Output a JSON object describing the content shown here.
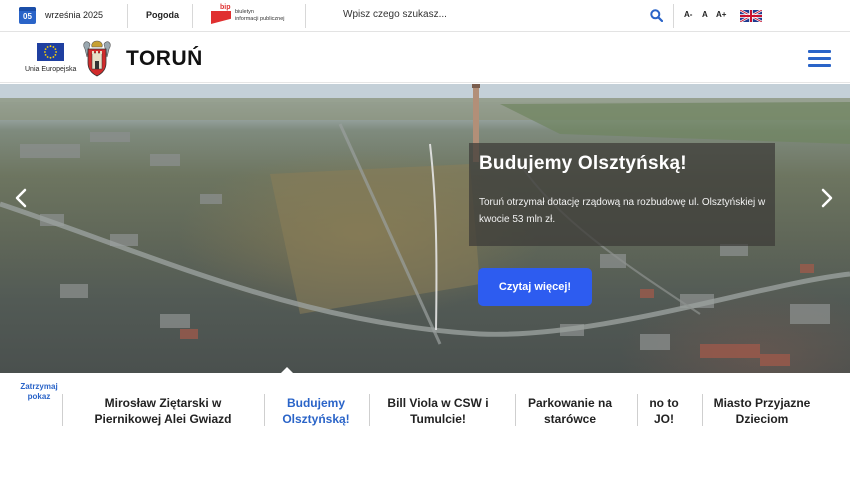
{
  "topbar": {
    "date_day": "05",
    "date_text": "września 2025",
    "weather_label": "Pogoda",
    "bip_word": "bip",
    "bip_line1": "biuletyn",
    "bip_line2": "informacji publicznej",
    "search_placeholder": "Wpisz czego szukasz...",
    "font_smaller": "A-",
    "font_normal": "A",
    "font_larger": "A+"
  },
  "logobar": {
    "eu_label": "Unia Europejska",
    "brand": "TORUŃ"
  },
  "hero": {
    "title": "Budujemy Olsztyńską!",
    "body": "Toruń otrzymał dotację rządową na rozbudowę ul. Olsztyńskiej w kwocie 53 mln zł.",
    "cta": "Czytaj więcej!"
  },
  "slider": {
    "stop_label": "Zatrzymaj pokaz",
    "tabs": [
      {
        "label": "Mirosław Ziętarski w Piernikowej Alei Gwiazd"
      },
      {
        "label": "Budujemy Olsztyńską!"
      },
      {
        "label": "Bill Viola w CSW i Tumulcie!"
      },
      {
        "label": "Parkowanie na starówce"
      },
      {
        "label": "no to JO!"
      },
      {
        "label": "Miasto Przyjazne Dzieciom"
      }
    ]
  },
  "colors": {
    "accent": "#2a64c8",
    "cta": "#2d5cf0",
    "bip_red": "#e03030"
  },
  "icons": [
    "calendar-icon",
    "search-icon",
    "uk-flag-icon",
    "eu-flag-icon",
    "torun-crest-icon",
    "hamburger-menu-icon",
    "chevron-left-icon",
    "chevron-right-icon"
  ]
}
